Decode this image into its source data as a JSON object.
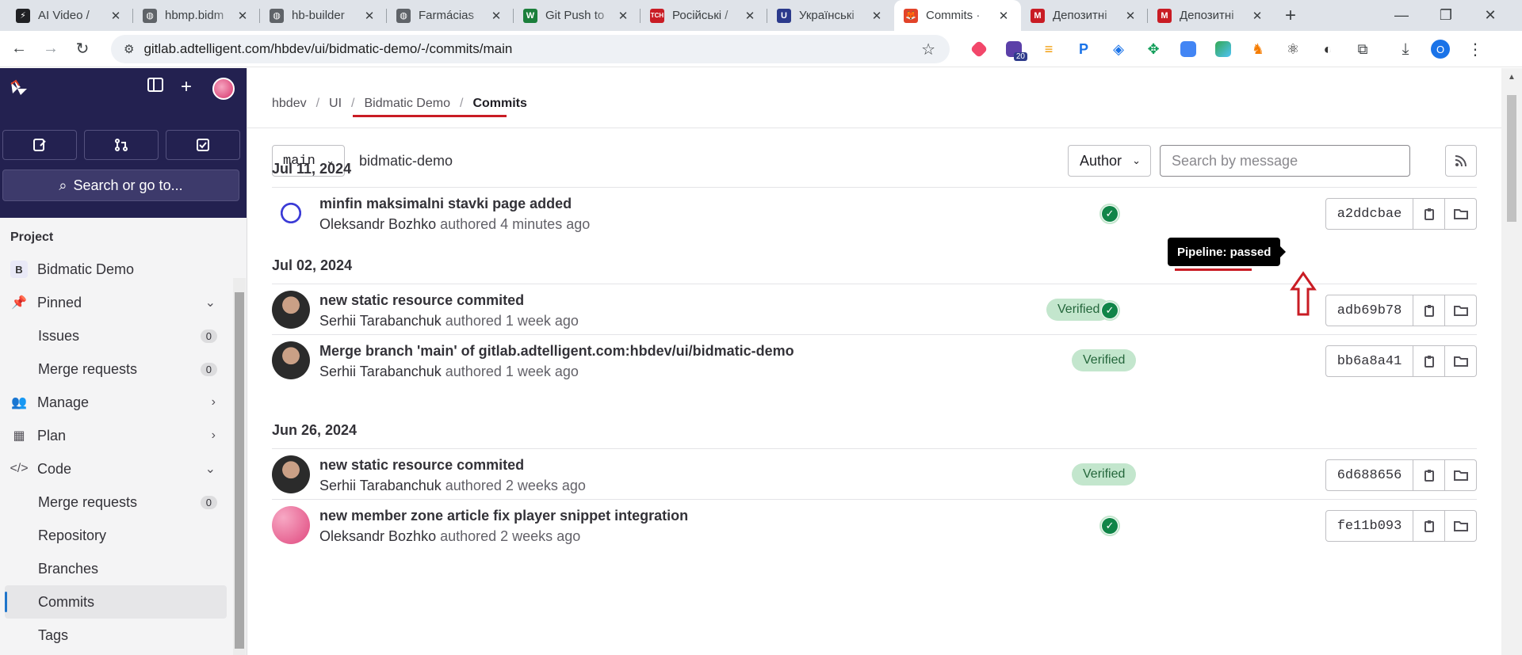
{
  "browser": {
    "tabs": [
      {
        "title": "AI Video /",
        "favicon_color": "#202124",
        "favicon_glyph": "⚡"
      },
      {
        "title": "hbmp.bidm",
        "favicon_color": "#5f6368",
        "favicon_glyph": "◍"
      },
      {
        "title": "hb-builder",
        "favicon_color": "#5f6368",
        "favicon_glyph": "◍"
      },
      {
        "title": "Farmácias",
        "favicon_color": "#5f6368",
        "favicon_glyph": "◍"
      },
      {
        "title": "Git Push to",
        "favicon_color": "#1b7f3b",
        "favicon_glyph": "W"
      },
      {
        "title": "Російські /",
        "favicon_color": "#c91c24",
        "favicon_glyph": "TCH"
      },
      {
        "title": "Українські",
        "favicon_color": "#2b3a8c",
        "favicon_glyph": "U"
      },
      {
        "title": "Commits ·",
        "favicon_color": "#e24329",
        "favicon_glyph": "🦊"
      },
      {
        "title": "Депозитні",
        "favicon_color": "#c91c24",
        "favicon_glyph": "M"
      },
      {
        "title": "Депозитні",
        "favicon_color": "#c91c24",
        "favicon_glyph": "M"
      }
    ],
    "active_tab_index": 7,
    "url": "gitlab.adtelligent.com/hbdev/ui/bidmatic-demo/-/commits/main",
    "profile_initial": "O",
    "extension_badge": "20"
  },
  "sidebar": {
    "search_label": "Search or go to...",
    "section_title": "Project",
    "project_initial": "B",
    "project_name": "Bidmatic Demo",
    "pinned": "Pinned",
    "issues": {
      "label": "Issues",
      "count": "0"
    },
    "merge_requests_pinned": {
      "label": "Merge requests",
      "count": "0"
    },
    "manage": "Manage",
    "plan": "Plan",
    "code": "Code",
    "merge_requests_code": {
      "label": "Merge requests",
      "count": "0"
    },
    "repository": "Repository",
    "branches": "Branches",
    "commits": "Commits",
    "tags": "Tags"
  },
  "breadcrumb": [
    "hbdev",
    "UI",
    "Bidmatic Demo",
    "Commits"
  ],
  "filters": {
    "branch": "main",
    "project_path": "bidmatic-demo",
    "author_label": "Author",
    "search_placeholder": "Search by message"
  },
  "commit_groups": [
    {
      "date": "Jul 11, 2024",
      "commits": [
        {
          "title": "minfin maksimalni stavki page added",
          "author": "Oleksandr Bozhko",
          "time": "authored 4 minutes ago",
          "verified": "",
          "pipeline": true,
          "sha": "a2ddcbae"
        }
      ]
    },
    {
      "date": "Jul 02, 2024",
      "commits": [
        {
          "title": "new static resource commited",
          "author": "Serhii Tarabanchuk",
          "time": "authored 1 week ago",
          "verified": "Verified",
          "pipeline": true,
          "sha": "adb69b78"
        },
        {
          "title": "Merge branch 'main' of gitlab.adtelligent.com:hbdev/ui/bidmatic-demo",
          "author": "Serhii Tarabanchuk",
          "time": "authored 1 week ago",
          "verified": "Verified",
          "pipeline": false,
          "sha": "bb6a8a41"
        }
      ]
    },
    {
      "date": "Jun 26, 2024",
      "commits": [
        {
          "title": "new static resource commited",
          "author": "Serhii Tarabanchuk",
          "time": "authored 2 weeks ago",
          "verified": "Verified",
          "pipeline": false,
          "sha": "6d688656"
        },
        {
          "title": "new member zone article fix player snippet integration",
          "author": "Oleksandr Bozhko",
          "time": "authored 2 weeks ago",
          "verified": "",
          "pipeline": true,
          "sha": "fe11b093"
        }
      ]
    }
  ],
  "tooltip": "Pipeline: passed",
  "colors": {
    "accent": "#1f75cb",
    "success": "#108548",
    "annotation": "#c91c24",
    "sidebar_dark": "#232150"
  }
}
